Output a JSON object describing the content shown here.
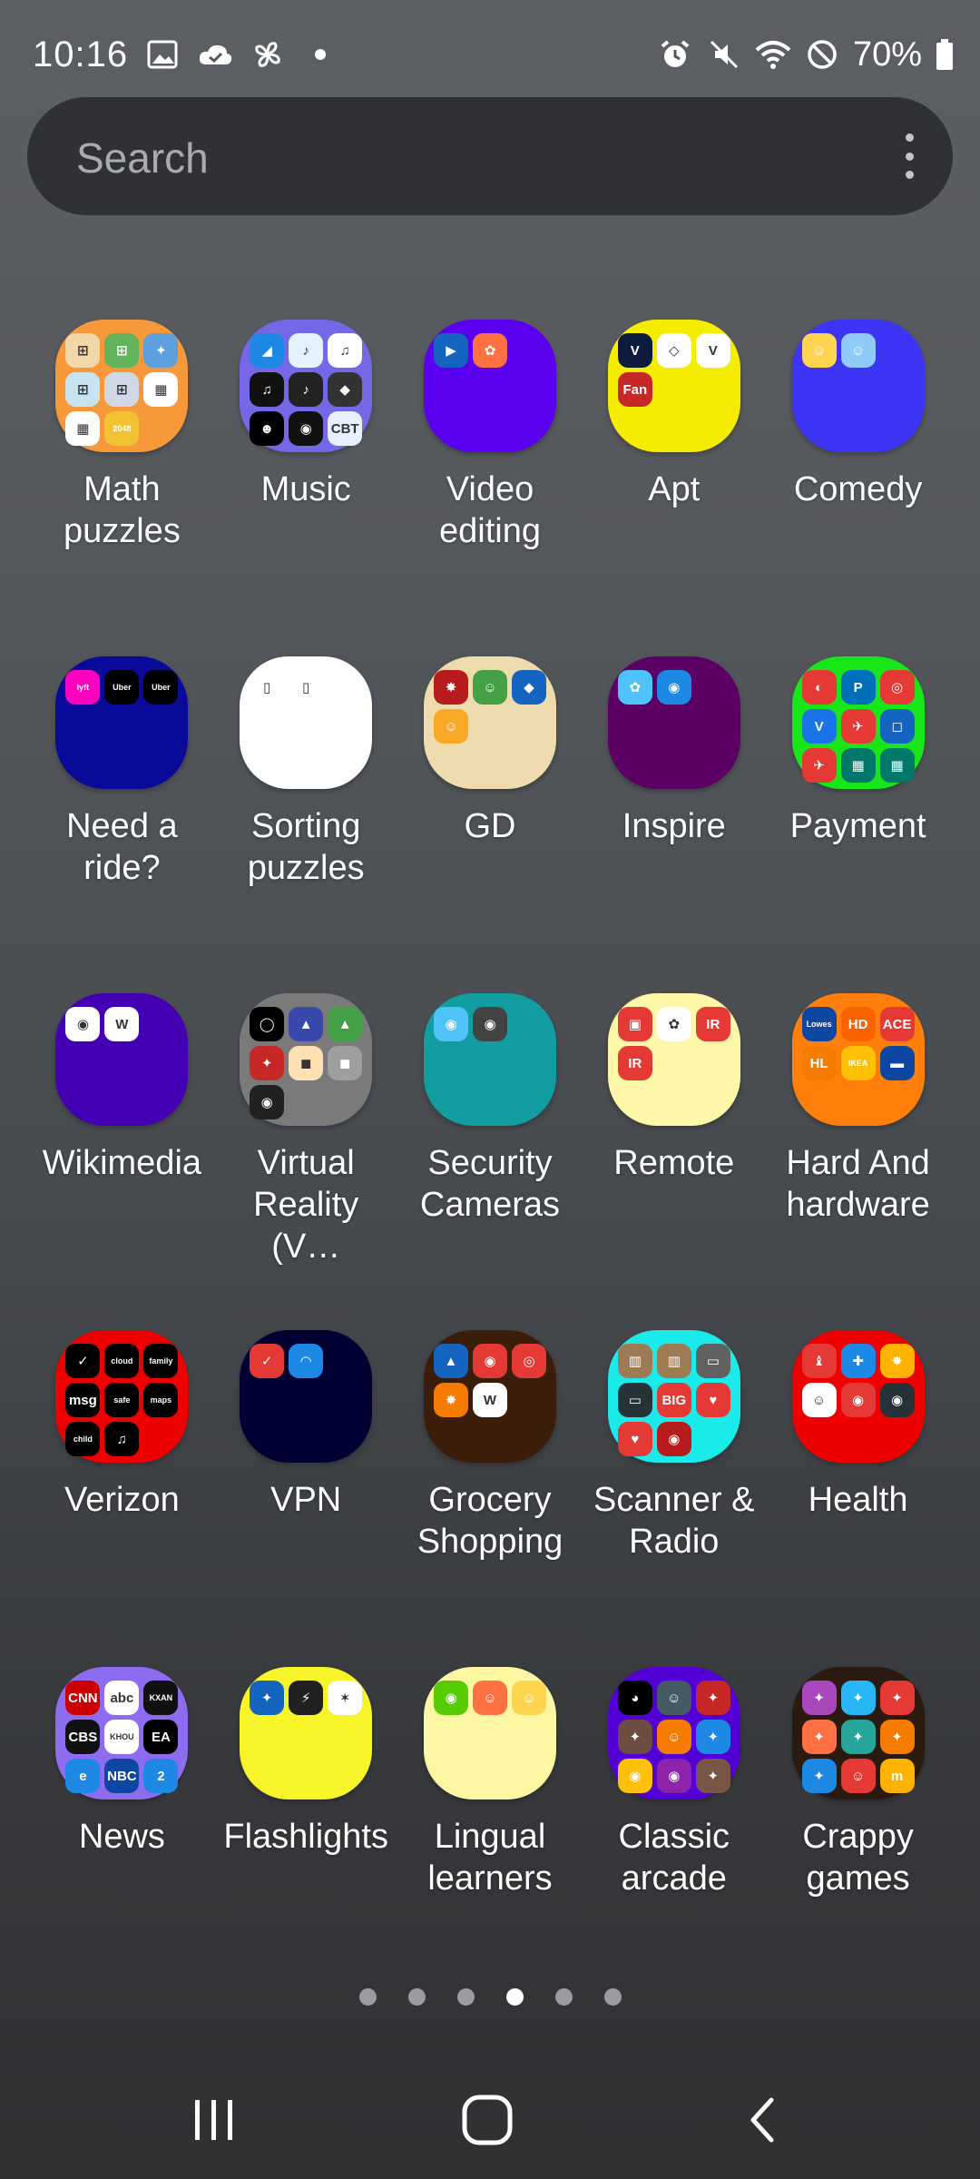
{
  "status_bar": {
    "time": "10:16",
    "battery_percent": "70%",
    "left_icons": [
      "image-icon",
      "cloud-icon",
      "pinwheel-icon",
      "dot-icon"
    ],
    "right_icons": [
      "alarm-icon",
      "mute-icon",
      "wifi-icon",
      "do-not-disturb-icon",
      "battery-icon"
    ]
  },
  "search": {
    "placeholder": "Search"
  },
  "folders": [
    {
      "label": "Math\npuzzles",
      "color": "#f7993a",
      "minis": [
        [
          "#f2d7a8",
          "⊞"
        ],
        [
          "#63b35a",
          "⊞"
        ],
        [
          "#5ea0dd",
          "✦"
        ],
        [
          "#c7e3ef",
          "⊞"
        ],
        [
          "#d0d8e6",
          "⊞"
        ],
        [
          "#ffffff",
          "▦"
        ],
        [
          "#ffffff",
          "▦"
        ],
        [
          "#f1c232",
          "2048"
        ]
      ]
    },
    {
      "label": "Music",
      "color": "#7468e6",
      "minis": [
        [
          "#1e88e5",
          "◢"
        ],
        [
          "#e3f2fd",
          "♪"
        ],
        [
          "#ffffff",
          "♫"
        ],
        [
          "#111111",
          "♫"
        ],
        [
          "#222222",
          "♪"
        ],
        [
          "#333333",
          "◆"
        ],
        [
          "#000000",
          "☻"
        ],
        [
          "#111111",
          "◉"
        ],
        [
          "#e8f0ff",
          "CBT"
        ]
      ]
    },
    {
      "label": "Video\nediting",
      "color": "#5a00ee",
      "minis": [
        [
          "#1565c0",
          "▶"
        ],
        [
          "#ff7043",
          "✿"
        ]
      ]
    },
    {
      "label": "Apt",
      "color": "#f5ec00",
      "minis": [
        [
          "#0d1b3d",
          "V"
        ],
        [
          "#ffffff",
          "◇"
        ],
        [
          "#ffffff",
          "V"
        ],
        [
          "#c62828",
          "Fan"
        ]
      ]
    },
    {
      "label": "Comedy",
      "color": "#3d34f5",
      "minis": [
        [
          "#ffd54f",
          "☺"
        ],
        [
          "#90caf9",
          "☺"
        ]
      ]
    },
    {
      "label": "Need a\nride?",
      "color": "#0a0a9a",
      "minis": [
        [
          "#ff00bf",
          "lyft"
        ],
        [
          "#000000",
          "Uber"
        ],
        [
          "#000000",
          "Uber"
        ]
      ]
    },
    {
      "label": "Sorting\npuzzles",
      "color": "#ffffff",
      "minis": [
        [
          "#ffffff",
          "▯"
        ],
        [
          "#ffffff",
          "▯"
        ]
      ]
    },
    {
      "label": "GD",
      "color": "#efdcae",
      "minis": [
        [
          "#b71c1c",
          "✸"
        ],
        [
          "#43a047",
          "☺"
        ],
        [
          "#1565c0",
          "◆"
        ],
        [
          "#f9a825",
          "☺"
        ]
      ]
    },
    {
      "label": "Inspire",
      "color": "#5c0066",
      "minis": [
        [
          "#4fc3f7",
          "✿"
        ],
        [
          "#1e88e5",
          "◉"
        ]
      ]
    },
    {
      "label": "Payment",
      "color": "#19e619",
      "minis": [
        [
          "#e53935",
          "◐"
        ],
        [
          "#0070ba",
          "P"
        ],
        [
          "#e53935",
          "◎"
        ],
        [
          "#1a73e8",
          "V"
        ],
        [
          "#e53935",
          "✈"
        ],
        [
          "#1565c0",
          "◻"
        ],
        [
          "#e53935",
          "✈"
        ],
        [
          "#00796b",
          "▦"
        ],
        [
          "#00796b",
          "▦"
        ]
      ]
    },
    {
      "label": "Wikimedia",
      "color": "#4400b3",
      "minis": [
        [
          "#ffffff",
          "◉"
        ],
        [
          "#ffffff",
          "W"
        ]
      ]
    },
    {
      "label": "Virtual\nReality (V…",
      "color": "#7a7a7a",
      "minis": [
        [
          "#000000",
          "◯"
        ],
        [
          "#3949ab",
          "▲"
        ],
        [
          "#43a047",
          "▲"
        ],
        [
          "#c62828",
          "✦"
        ],
        [
          "#ffe0b2",
          "◼"
        ],
        [
          "#9e9e9e",
          "◼"
        ],
        [
          "#212121",
          "◉"
        ]
      ]
    },
    {
      "label": "Security\nCameras",
      "color": "#129ea0",
      "minis": [
        [
          "#4fc3f7",
          "◉"
        ],
        [
          "#424242",
          "◉"
        ]
      ]
    },
    {
      "label": "Remote",
      "color": "#fff7a8",
      "minis": [
        [
          "#e53935",
          "▣"
        ],
        [
          "#ffffff",
          "✿"
        ],
        [
          "#e53935",
          "IR"
        ],
        [
          "#e53935",
          "IR"
        ]
      ]
    },
    {
      "label": "Hard And\nhardware",
      "color": "#ff7f0a",
      "minis": [
        [
          "#0d47a1",
          "Lowes"
        ],
        [
          "#f96302",
          "HD"
        ],
        [
          "#e53935",
          "ACE"
        ],
        [
          "#f57c00",
          "HL"
        ],
        [
          "#ffc107",
          "IKEA"
        ],
        [
          "#0d47a1",
          "▬"
        ]
      ]
    },
    {
      "label": "Verizon",
      "color": "#ef0000",
      "minis": [
        [
          "#000000",
          "✓"
        ],
        [
          "#000000",
          "cloud"
        ],
        [
          "#000000",
          "family"
        ],
        [
          "#000000",
          "msg"
        ],
        [
          "#000000",
          "safe"
        ],
        [
          "#000000",
          "maps"
        ],
        [
          "#000000",
          "child"
        ],
        [
          "#000000",
          "♫"
        ]
      ]
    },
    {
      "label": "VPN",
      "color": "#000033",
      "minis": [
        [
          "#e53935",
          "✓"
        ],
        [
          "#1e88e5",
          "◠"
        ]
      ]
    },
    {
      "label": "Grocery\nShopping",
      "color": "#3a1e0a",
      "minis": [
        [
          "#1565c0",
          "▲"
        ],
        [
          "#e53935",
          "◉"
        ],
        [
          "#e53935",
          "◎"
        ],
        [
          "#f57c00",
          "✸"
        ],
        [
          "#ffffff",
          "W"
        ]
      ]
    },
    {
      "label": "Scanner &\nRadio",
      "color": "#1aeaea",
      "minis": [
        [
          "#9e7b54",
          "▥"
        ],
        [
          "#9e7b54",
          "▥"
        ],
        [
          "#616161",
          "▭"
        ],
        [
          "#263238",
          "▭"
        ],
        [
          "#e53935",
          "BIG"
        ],
        [
          "#e53935",
          "♥"
        ],
        [
          "#e53935",
          "♥"
        ],
        [
          "#b71c1c",
          "◉"
        ]
      ]
    },
    {
      "label": "Health",
      "color": "#ef0000",
      "minis": [
        [
          "#e53935",
          "♝"
        ],
        [
          "#1e88e5",
          "✚"
        ],
        [
          "#ffb300",
          "✸"
        ],
        [
          "#ffffff",
          "☺"
        ],
        [
          "#e53935",
          "◉"
        ],
        [
          "#263238",
          "◉"
        ]
      ]
    },
    {
      "label": "News",
      "color": "#8e6cf0",
      "minis": [
        [
          "#cc0000",
          "CNN"
        ],
        [
          "#ffffff",
          "abc"
        ],
        [
          "#111111",
          "KXAN"
        ],
        [
          "#111111",
          "CBS"
        ],
        [
          "#ffffff",
          "KHOU"
        ],
        [
          "#000000",
          "EA"
        ],
        [
          "#1e88e5",
          "e"
        ],
        [
          "#0d47a1",
          "NBC"
        ],
        [
          "#1e88e5",
          "2"
        ]
      ]
    },
    {
      "label": "Flashlights",
      "color": "#f7f52a",
      "minis": [
        [
          "#1565c0",
          "✦"
        ],
        [
          "#212121",
          "⚡"
        ],
        [
          "#ffffff",
          "✶"
        ]
      ]
    },
    {
      "label": "Lingual\nlearners",
      "color": "#fdf7a3",
      "minis": [
        [
          "#58cc02",
          "◉"
        ],
        [
          "#ff7043",
          "☺"
        ],
        [
          "#ffd54f",
          "☺"
        ]
      ]
    },
    {
      "label": "Classic\narcade",
      "color": "#5300d6",
      "minis": [
        [
          "#000000",
          "◕"
        ],
        [
          "#455a64",
          "☺"
        ],
        [
          "#c62828",
          "✦"
        ],
        [
          "#6d4c41",
          "✦"
        ],
        [
          "#f57c00",
          "☺"
        ],
        [
          "#1e88e5",
          "✦"
        ],
        [
          "#ffc107",
          "◉"
        ],
        [
          "#8e24aa",
          "◉"
        ],
        [
          "#795548",
          "✦"
        ]
      ]
    },
    {
      "label": "Crappy\ngames",
      "color": "#2a1a10",
      "minis": [
        [
          "#ab47bc",
          "✦"
        ],
        [
          "#29b6f6",
          "✦"
        ],
        [
          "#e53935",
          "✦"
        ],
        [
          "#ff7043",
          "✦"
        ],
        [
          "#26a69a",
          "✦"
        ],
        [
          "#f57c00",
          "✦"
        ],
        [
          "#1e88e5",
          "✦"
        ],
        [
          "#e53935",
          "☺"
        ],
        [
          "#ffb300",
          "m"
        ]
      ]
    }
  ],
  "pager": {
    "count": 6,
    "active_index": 3
  },
  "nav": {
    "recents": "recents-icon",
    "home": "home-icon",
    "back": "back-icon"
  }
}
